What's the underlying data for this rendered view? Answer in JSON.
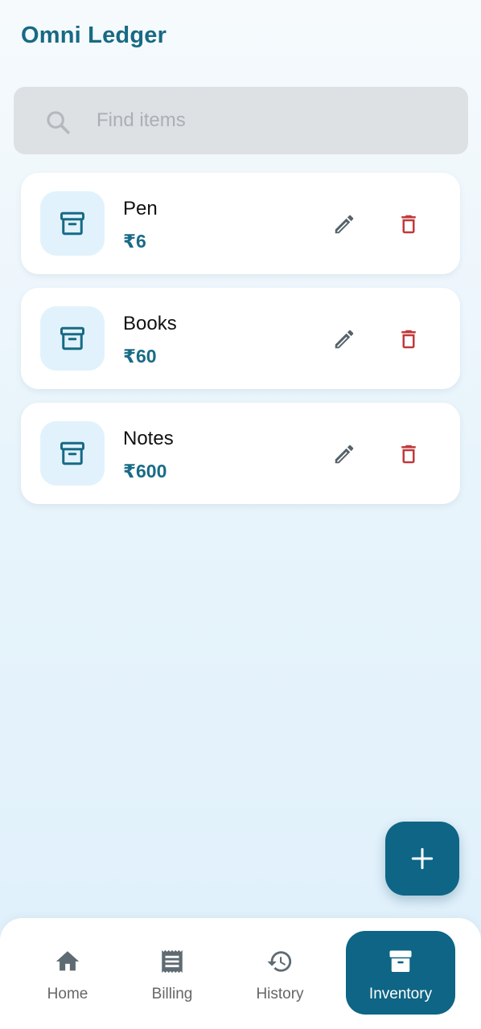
{
  "app": {
    "title": "Omni Ledger"
  },
  "search": {
    "placeholder": "Find items",
    "value": ""
  },
  "items": [
    {
      "name": "Pen",
      "price": "₹6"
    },
    {
      "name": "Books",
      "price": "₹60"
    },
    {
      "name": "Notes",
      "price": "₹600"
    }
  ],
  "icons": {
    "search": "search-icon",
    "item": "archive-box-icon",
    "edit": "pencil-icon",
    "delete": "trash-icon",
    "add": "plus-icon"
  },
  "colors": {
    "brand": "#176a84",
    "accent": "#0e6585",
    "delete": "#c0393b",
    "thumb_bg": "#e1f2fc"
  },
  "nav": {
    "items": [
      {
        "label": "Home",
        "icon": "home-icon",
        "active": false
      },
      {
        "label": "Billing",
        "icon": "receipt-icon",
        "active": false
      },
      {
        "label": "History",
        "icon": "history-icon",
        "active": false
      },
      {
        "label": "Inventory",
        "icon": "archive-box-icon",
        "active": true
      }
    ]
  }
}
